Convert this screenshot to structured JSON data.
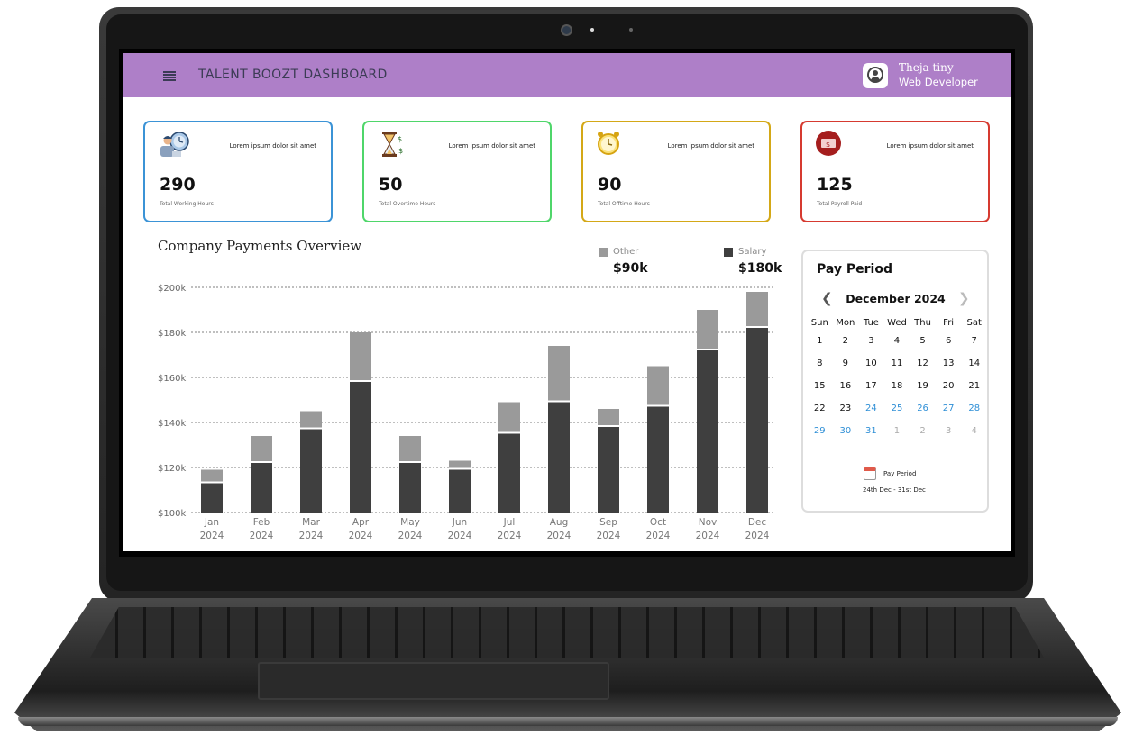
{
  "header": {
    "app_title": "TALENT BOOZT DASHBOARD",
    "user_name": "Theja tiny",
    "user_role": "Web Developer"
  },
  "cards": [
    {
      "desc": "Lorem ipsum dolor sit amet",
      "value": "290",
      "label": "Total Working Hours",
      "color": "#3b93d6",
      "icon": "worker-clock-icon"
    },
    {
      "desc": "Lorem ipsum dolor sit amet",
      "value": "50",
      "label": "Total Overtime Hours",
      "color": "#4fd66a",
      "icon": "hourglass-money-icon"
    },
    {
      "desc": "Lorem ipsum dolor sit amet",
      "value": "90",
      "label": "Total Offtime Hours",
      "color": "#d4a817",
      "icon": "alarm-clock-icon"
    },
    {
      "desc": "Lorem ipsum dolor sit amet",
      "value": "125",
      "label": "Total Payroll Paid",
      "color": "#d63a30",
      "icon": "money-icon"
    }
  ],
  "chart_section": {
    "legend": [
      {
        "name": "Other",
        "value": "$90k",
        "color": "#9a9a9a"
      },
      {
        "name": "Salary",
        "value": "$180k",
        "color": "#3f3f3f"
      }
    ]
  },
  "chart_data": {
    "type": "bar",
    "stacked": true,
    "title": "Company Payments Overview",
    "categories": [
      "Jan",
      "Feb",
      "Mar",
      "Apr",
      "May",
      "Jun",
      "Jul",
      "Aug",
      "Sep",
      "Oct",
      "Nov",
      "Dec"
    ],
    "category_years": [
      "2024",
      "2024",
      "2024",
      "2024",
      "2024",
      "2024",
      "2024",
      "2024",
      "2024",
      "2024",
      "2024",
      "2024"
    ],
    "series": [
      {
        "name": "Salary",
        "values": [
          113,
          122,
          137,
          158,
          122,
          119,
          135,
          149,
          138,
          147,
          172,
          182
        ]
      },
      {
        "name": "Other",
        "values": [
          6,
          12,
          8,
          22,
          12,
          4,
          14,
          25,
          8,
          18,
          18,
          16
        ]
      }
    ],
    "y_ticks": [
      "$100k",
      "$120k",
      "$140k",
      "$160k",
      "$180k",
      "$200k"
    ],
    "ylim": [
      100,
      200
    ],
    "grid": true,
    "legend_position": "top-right"
  },
  "calendar": {
    "title": "Pay Period",
    "month_label": "December 2024",
    "weekdays": [
      "Sun",
      "Mon",
      "Tue",
      "Wed",
      "Thu",
      "Fri",
      "Sat"
    ],
    "days": [
      {
        "n": "1",
        "s": "normal"
      },
      {
        "n": "2",
        "s": "normal"
      },
      {
        "n": "3",
        "s": "normal"
      },
      {
        "n": "4",
        "s": "normal"
      },
      {
        "n": "5",
        "s": "normal"
      },
      {
        "n": "6",
        "s": "normal"
      },
      {
        "n": "7",
        "s": "normal"
      },
      {
        "n": "8",
        "s": "normal"
      },
      {
        "n": "9",
        "s": "normal"
      },
      {
        "n": "10",
        "s": "normal"
      },
      {
        "n": "11",
        "s": "normal"
      },
      {
        "n": "12",
        "s": "normal"
      },
      {
        "n": "13",
        "s": "normal"
      },
      {
        "n": "14",
        "s": "normal"
      },
      {
        "n": "15",
        "s": "normal"
      },
      {
        "n": "16",
        "s": "normal"
      },
      {
        "n": "17",
        "s": "normal"
      },
      {
        "n": "18",
        "s": "normal"
      },
      {
        "n": "19",
        "s": "normal"
      },
      {
        "n": "20",
        "s": "normal"
      },
      {
        "n": "21",
        "s": "normal"
      },
      {
        "n": "22",
        "s": "normal"
      },
      {
        "n": "23",
        "s": "normal"
      },
      {
        "n": "24",
        "s": "selected"
      },
      {
        "n": "25",
        "s": "selected"
      },
      {
        "n": "26",
        "s": "selected"
      },
      {
        "n": "27",
        "s": "selected"
      },
      {
        "n": "28",
        "s": "selected"
      },
      {
        "n": "29",
        "s": "selected"
      },
      {
        "n": "30",
        "s": "selected"
      },
      {
        "n": "31",
        "s": "selected"
      },
      {
        "n": "1",
        "s": "next"
      },
      {
        "n": "2",
        "s": "next"
      },
      {
        "n": "3",
        "s": "next"
      },
      {
        "n": "4",
        "s": "next"
      }
    ],
    "pay_period_label": "Pay Period",
    "pay_period_range": "24th Dec - 31st Dec",
    "selected_color": "#2f8fd6"
  },
  "theme": {
    "header_bg": "#ae7fc8"
  }
}
